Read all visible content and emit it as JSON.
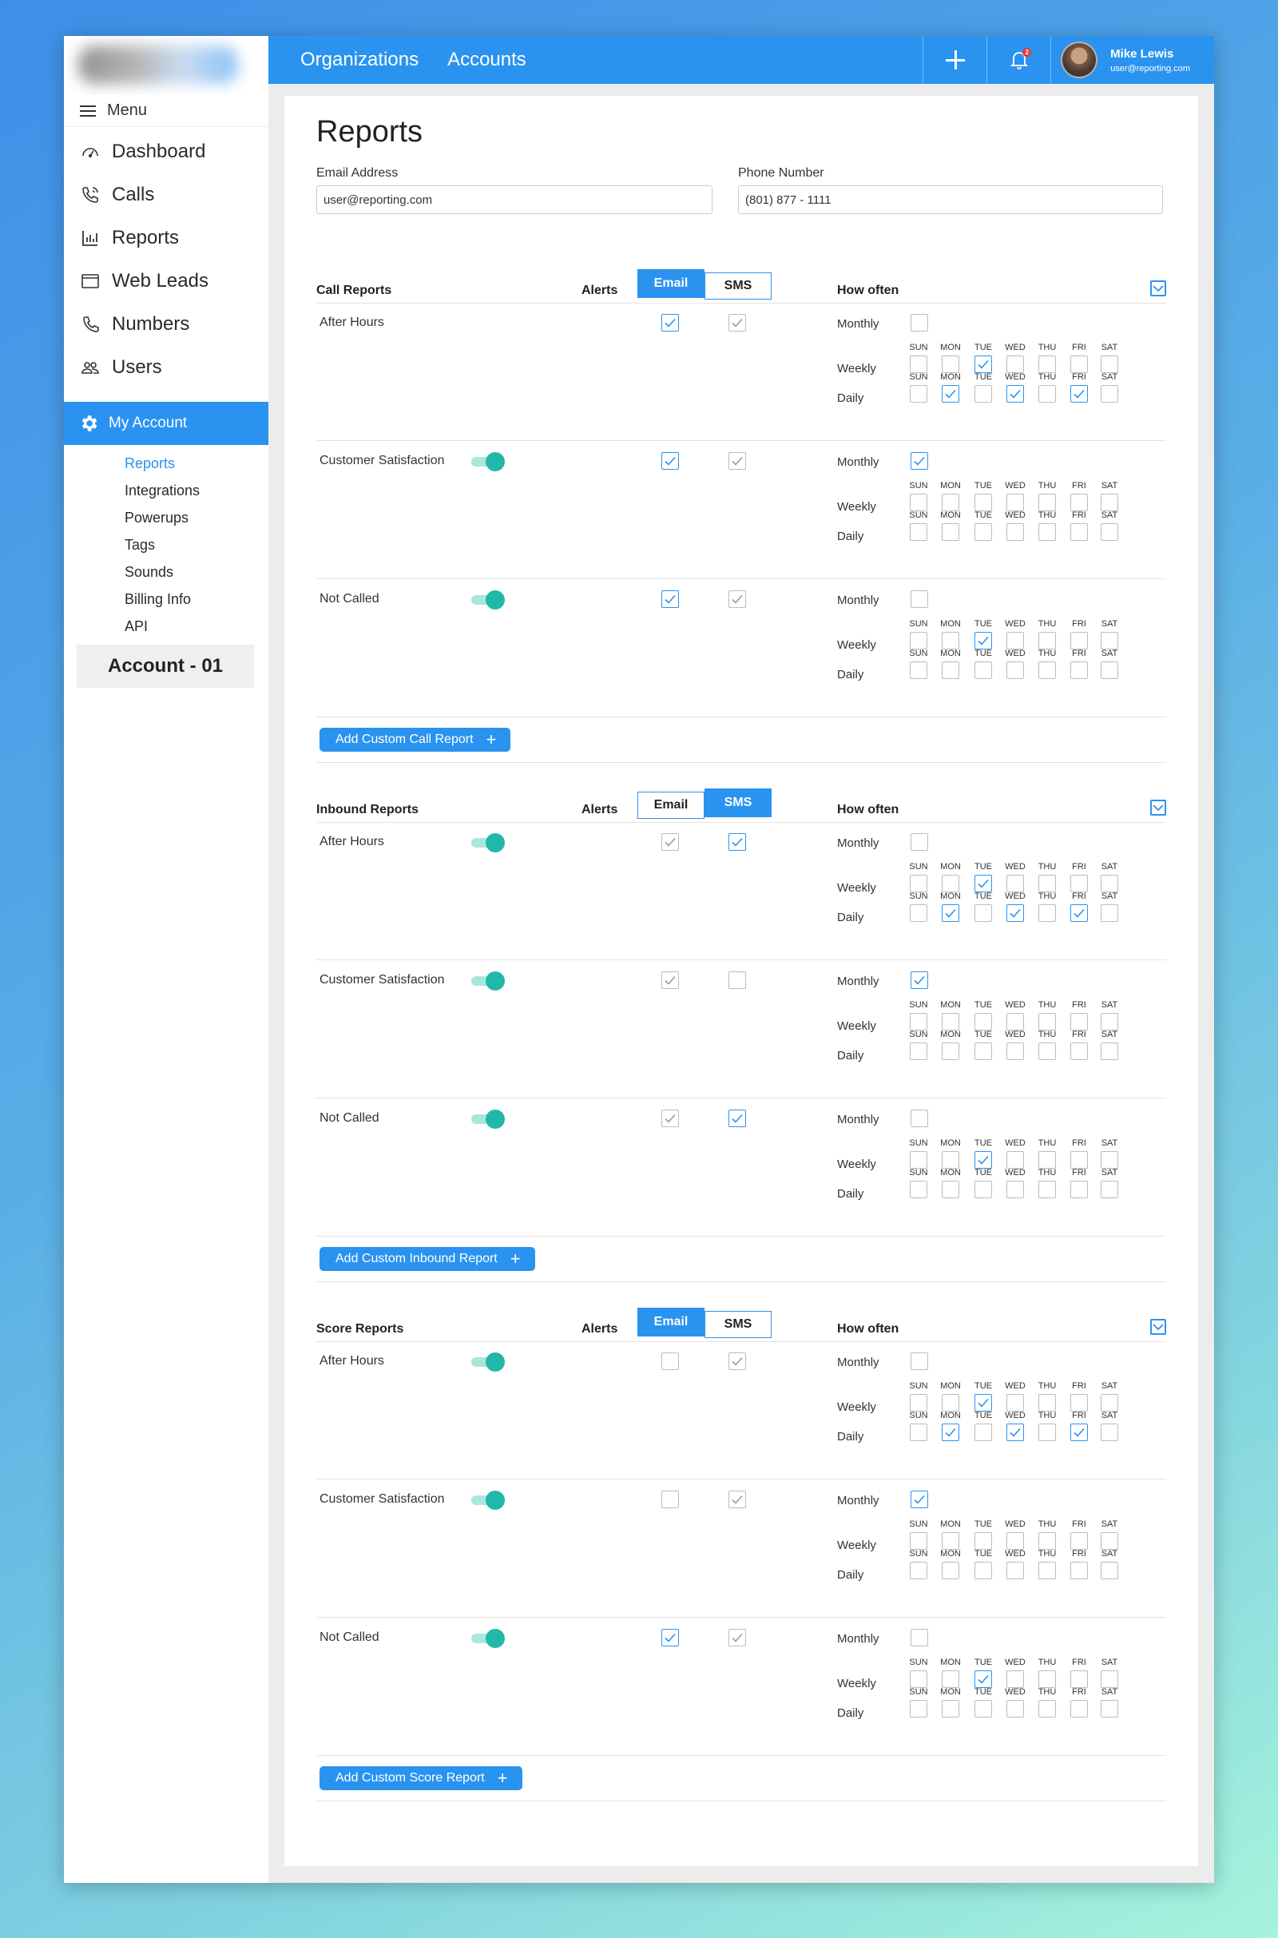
{
  "sidebar": {
    "menu_label": "Menu",
    "nav": [
      {
        "label": "Dashboard",
        "icon": "gauge-icon"
      },
      {
        "label": "Calls",
        "icon": "phone-ring-icon"
      },
      {
        "label": "Reports",
        "icon": "bar-chart-icon"
      },
      {
        "label": "Web Leads",
        "icon": "browser-icon"
      },
      {
        "label": "Numbers",
        "icon": "phone-icon"
      },
      {
        "label": "Users",
        "icon": "users-icon"
      }
    ],
    "my_account": "My Account",
    "sub_items": [
      "Reports",
      "Integrations",
      "Powerups",
      "Tags",
      "Sounds",
      "Billing Info",
      "API"
    ],
    "active_sub": "Reports",
    "account_name": "Account - 01"
  },
  "topbar": {
    "links": [
      "Organizations",
      "Accounts"
    ],
    "notification_count": "2",
    "user_name": "Mike Lewis",
    "user_email": "user@reporting.com"
  },
  "page": {
    "title": "Reports",
    "email_label": "Email Address",
    "email_value": "user@reporting.com",
    "phone_label": "Phone Number",
    "phone_value": "(801) 877 - 1111"
  },
  "labels": {
    "alerts": "Alerts",
    "email": "Email",
    "sms": "SMS",
    "how_often": "How often",
    "monthly": "Monthly",
    "weekly": "Weekly",
    "daily": "Daily",
    "days": [
      "SUN",
      "MON",
      "TUE",
      "WED",
      "THU",
      "FRI",
      "SAT"
    ]
  },
  "colors": {
    "accent": "#2a93f0",
    "toggle": "#21b8aa"
  },
  "sections": [
    {
      "title": "Call Reports",
      "active_tab": "email",
      "add_label": "Add Custom Call Report",
      "rows": [
        {
          "label": "After Hours",
          "toggle": false,
          "email": true,
          "sms": true,
          "monthly": false,
          "weekly": [
            0,
            0,
            1,
            0,
            0,
            0,
            0
          ],
          "daily": [
            0,
            1,
            0,
            1,
            0,
            1,
            0
          ]
        },
        {
          "label": "Customer Satisfaction",
          "toggle": true,
          "email": true,
          "sms": true,
          "monthly": true,
          "weekly": [
            0,
            0,
            0,
            0,
            0,
            0,
            0
          ],
          "daily": [
            0,
            0,
            0,
            0,
            0,
            0,
            0
          ]
        },
        {
          "label": "Not Called",
          "toggle": true,
          "email": true,
          "sms": true,
          "monthly": false,
          "weekly": [
            0,
            0,
            1,
            0,
            0,
            0,
            0
          ],
          "daily": [
            0,
            0,
            0,
            0,
            0,
            0,
            0
          ]
        }
      ]
    },
    {
      "title": "Inbound Reports",
      "active_tab": "sms",
      "add_label": "Add Custom Inbound Report",
      "rows": [
        {
          "label": "After Hours",
          "toggle": true,
          "email": true,
          "sms": true,
          "monthly": false,
          "weekly": [
            0,
            0,
            1,
            0,
            0,
            0,
            0
          ],
          "daily": [
            0,
            1,
            0,
            1,
            0,
            1,
            0
          ]
        },
        {
          "label": "Customer Satisfaction",
          "toggle": true,
          "email": true,
          "sms": false,
          "monthly": true,
          "weekly": [
            0,
            0,
            0,
            0,
            0,
            0,
            0
          ],
          "daily": [
            0,
            0,
            0,
            0,
            0,
            0,
            0
          ]
        },
        {
          "label": "Not Called",
          "toggle": true,
          "email": true,
          "sms": true,
          "monthly": false,
          "weekly": [
            0,
            0,
            1,
            0,
            0,
            0,
            0
          ],
          "daily": [
            0,
            0,
            0,
            0,
            0,
            0,
            0
          ]
        }
      ]
    },
    {
      "title": "Score Reports",
      "active_tab": "email",
      "add_label": "Add Custom Score Report",
      "rows": [
        {
          "label": "After Hours",
          "toggle": true,
          "email": false,
          "sms": true,
          "monthly": false,
          "weekly": [
            0,
            0,
            1,
            0,
            0,
            0,
            0
          ],
          "daily": [
            0,
            1,
            0,
            1,
            0,
            1,
            0
          ]
        },
        {
          "label": "Customer Satisfaction",
          "toggle": true,
          "email": false,
          "sms": true,
          "monthly": true,
          "weekly": [
            0,
            0,
            0,
            0,
            0,
            0,
            0
          ],
          "daily": [
            0,
            0,
            0,
            0,
            0,
            0,
            0
          ]
        },
        {
          "label": "Not Called",
          "toggle": true,
          "email": true,
          "sms": true,
          "monthly": false,
          "weekly": [
            0,
            0,
            1,
            0,
            0,
            0,
            0
          ],
          "daily": [
            0,
            0,
            0,
            0,
            0,
            0,
            0
          ]
        }
      ]
    }
  ]
}
